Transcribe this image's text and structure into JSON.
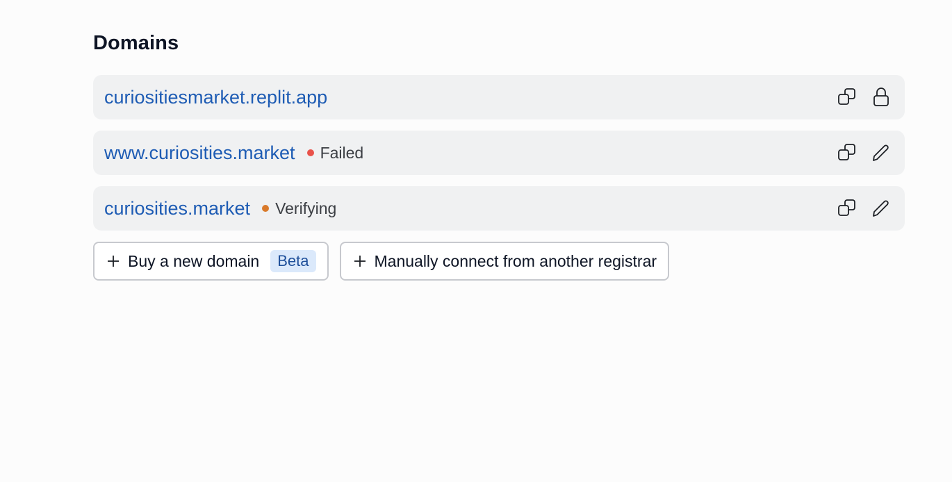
{
  "section": {
    "title": "Domains"
  },
  "domains": [
    {
      "name": "curiositiesmarket.replit.app",
      "status": "",
      "status_color": "",
      "actions": [
        "copy-icon",
        "lock-icon"
      ]
    },
    {
      "name": "www.curiosities.market",
      "status": "Failed",
      "status_color": "#e9524a",
      "actions": [
        "copy-icon",
        "pencil-icon"
      ]
    },
    {
      "name": "curiosities.market",
      "status": "Verifying",
      "status_color": "#d97a2b",
      "actions": [
        "copy-icon",
        "pencil-icon"
      ]
    }
  ],
  "buttons": {
    "buy_label": "Buy a new domain",
    "beta_badge": "Beta",
    "connect_label": "Manually connect from another registrar"
  },
  "colors": {
    "link": "#1e5cb4",
    "row_bg": "#f0f1f2",
    "failed": "#e9524a",
    "verifying": "#d97a2b",
    "badge_bg": "#dbe9fb"
  }
}
